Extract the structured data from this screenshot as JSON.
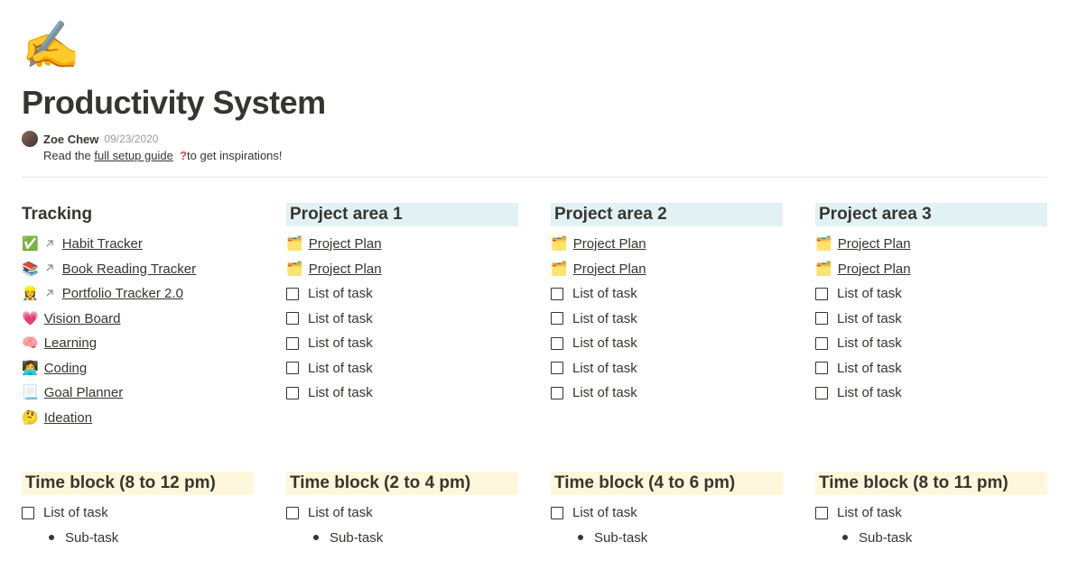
{
  "header": {
    "icon": "✍️",
    "title": "Productivity System",
    "author": "Zoe Chew",
    "date": "09/23/2020",
    "subtitle_prefix": "Read the ",
    "subtitle_link": "full setup guide",
    "subtitle_q": "?",
    "subtitle_suffix": "to get inspirations!"
  },
  "tracking": {
    "heading": "Tracking",
    "items": [
      {
        "emoji": "✅",
        "hasArrow": true,
        "label": "Habit Tracker"
      },
      {
        "emoji": "📚",
        "hasArrow": true,
        "label": "Book Reading Tracker"
      },
      {
        "emoji": "👷‍♀️",
        "hasArrow": true,
        "label": "Portfolio Tracker 2.0"
      },
      {
        "emoji": "💗",
        "hasArrow": false,
        "label": "Vision Board"
      },
      {
        "emoji": "🧠",
        "hasArrow": false,
        "label": "Learning"
      },
      {
        "emoji": "👩‍💻",
        "hasArrow": false,
        "label": "Coding"
      },
      {
        "emoji": "📃",
        "hasArrow": false,
        "label": "Goal Planner"
      },
      {
        "emoji": "🤔",
        "hasArrow": false,
        "label": "Ideation"
      }
    ]
  },
  "project_areas": [
    {
      "heading": "Project area 1",
      "plans": [
        {
          "emoji": "🗂️",
          "label": "Project Plan"
        },
        {
          "emoji": "🗂️",
          "label": "Project Plan"
        }
      ],
      "tasks": [
        "List of task",
        "List of task",
        "List of task",
        "List of task",
        "List of task"
      ]
    },
    {
      "heading": "Project area 2",
      "plans": [
        {
          "emoji": "🗂️",
          "label": "Project Plan"
        },
        {
          "emoji": "🗂️",
          "label": "Project Plan"
        }
      ],
      "tasks": [
        "List of task",
        "List of task",
        "List of task",
        "List of task",
        "List of task"
      ]
    },
    {
      "heading": "Project area 3",
      "plans": [
        {
          "emoji": "🗂️",
          "label": "Project Plan"
        },
        {
          "emoji": "🗂️",
          "label": "Project Plan"
        }
      ],
      "tasks": [
        "List of task",
        "List of task",
        "List of task",
        "List of task",
        "List of task"
      ]
    }
  ],
  "time_blocks": [
    {
      "heading": "Time block (8 to 12 pm)",
      "task": "List of task",
      "sub": "Sub-task"
    },
    {
      "heading": "Time block (2 to 4 pm)",
      "task": "List of task",
      "sub": "Sub-task"
    },
    {
      "heading": "Time block (4 to 6 pm)",
      "task": "List of task",
      "sub": "Sub-task"
    },
    {
      "heading": "Time block (8 to 11 pm)",
      "task": "List of task",
      "sub": "Sub-task"
    }
  ]
}
